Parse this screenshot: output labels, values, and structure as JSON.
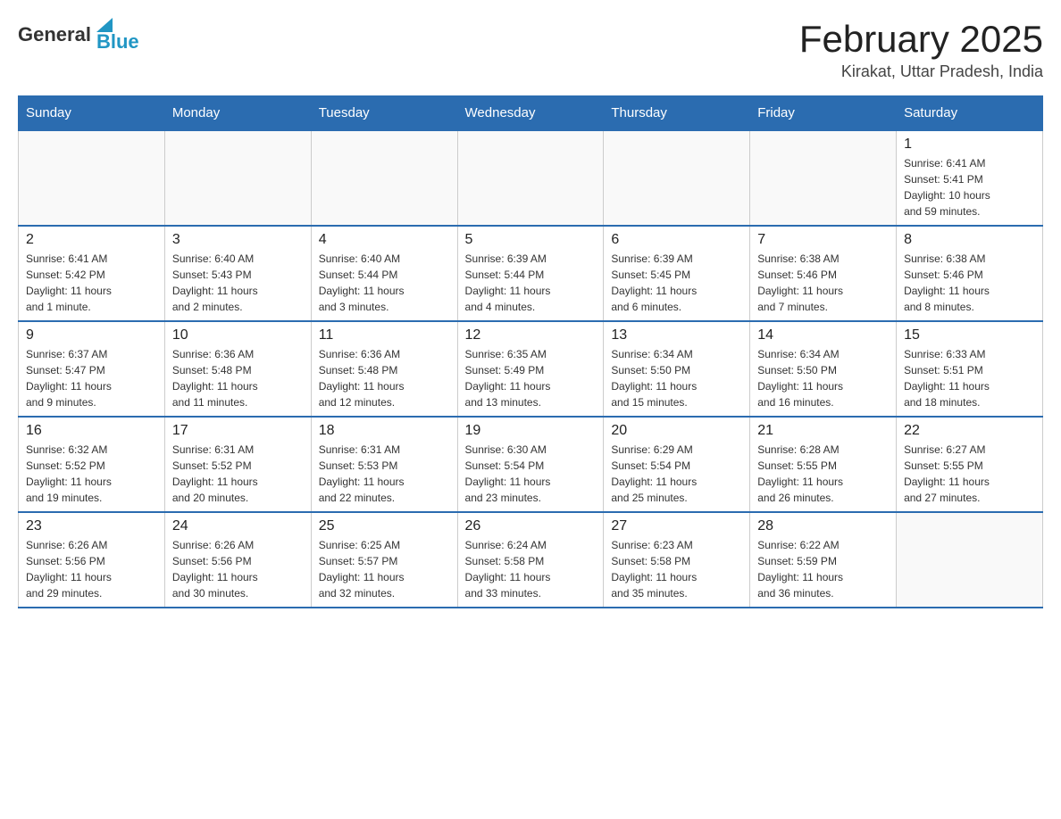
{
  "header": {
    "logo_general": "General",
    "logo_blue": "Blue",
    "month_year": "February 2025",
    "location": "Kirakat, Uttar Pradesh, India"
  },
  "days_of_week": [
    "Sunday",
    "Monday",
    "Tuesday",
    "Wednesday",
    "Thursday",
    "Friday",
    "Saturday"
  ],
  "weeks": [
    {
      "days": [
        {
          "number": "",
          "info": ""
        },
        {
          "number": "",
          "info": ""
        },
        {
          "number": "",
          "info": ""
        },
        {
          "number": "",
          "info": ""
        },
        {
          "number": "",
          "info": ""
        },
        {
          "number": "",
          "info": ""
        },
        {
          "number": "1",
          "info": "Sunrise: 6:41 AM\nSunset: 5:41 PM\nDaylight: 10 hours\nand 59 minutes."
        }
      ]
    },
    {
      "days": [
        {
          "number": "2",
          "info": "Sunrise: 6:41 AM\nSunset: 5:42 PM\nDaylight: 11 hours\nand 1 minute."
        },
        {
          "number": "3",
          "info": "Sunrise: 6:40 AM\nSunset: 5:43 PM\nDaylight: 11 hours\nand 2 minutes."
        },
        {
          "number": "4",
          "info": "Sunrise: 6:40 AM\nSunset: 5:44 PM\nDaylight: 11 hours\nand 3 minutes."
        },
        {
          "number": "5",
          "info": "Sunrise: 6:39 AM\nSunset: 5:44 PM\nDaylight: 11 hours\nand 4 minutes."
        },
        {
          "number": "6",
          "info": "Sunrise: 6:39 AM\nSunset: 5:45 PM\nDaylight: 11 hours\nand 6 minutes."
        },
        {
          "number": "7",
          "info": "Sunrise: 6:38 AM\nSunset: 5:46 PM\nDaylight: 11 hours\nand 7 minutes."
        },
        {
          "number": "8",
          "info": "Sunrise: 6:38 AM\nSunset: 5:46 PM\nDaylight: 11 hours\nand 8 minutes."
        }
      ]
    },
    {
      "days": [
        {
          "number": "9",
          "info": "Sunrise: 6:37 AM\nSunset: 5:47 PM\nDaylight: 11 hours\nand 9 minutes."
        },
        {
          "number": "10",
          "info": "Sunrise: 6:36 AM\nSunset: 5:48 PM\nDaylight: 11 hours\nand 11 minutes."
        },
        {
          "number": "11",
          "info": "Sunrise: 6:36 AM\nSunset: 5:48 PM\nDaylight: 11 hours\nand 12 minutes."
        },
        {
          "number": "12",
          "info": "Sunrise: 6:35 AM\nSunset: 5:49 PM\nDaylight: 11 hours\nand 13 minutes."
        },
        {
          "number": "13",
          "info": "Sunrise: 6:34 AM\nSunset: 5:50 PM\nDaylight: 11 hours\nand 15 minutes."
        },
        {
          "number": "14",
          "info": "Sunrise: 6:34 AM\nSunset: 5:50 PM\nDaylight: 11 hours\nand 16 minutes."
        },
        {
          "number": "15",
          "info": "Sunrise: 6:33 AM\nSunset: 5:51 PM\nDaylight: 11 hours\nand 18 minutes."
        }
      ]
    },
    {
      "days": [
        {
          "number": "16",
          "info": "Sunrise: 6:32 AM\nSunset: 5:52 PM\nDaylight: 11 hours\nand 19 minutes."
        },
        {
          "number": "17",
          "info": "Sunrise: 6:31 AM\nSunset: 5:52 PM\nDaylight: 11 hours\nand 20 minutes."
        },
        {
          "number": "18",
          "info": "Sunrise: 6:31 AM\nSunset: 5:53 PM\nDaylight: 11 hours\nand 22 minutes."
        },
        {
          "number": "19",
          "info": "Sunrise: 6:30 AM\nSunset: 5:54 PM\nDaylight: 11 hours\nand 23 minutes."
        },
        {
          "number": "20",
          "info": "Sunrise: 6:29 AM\nSunset: 5:54 PM\nDaylight: 11 hours\nand 25 minutes."
        },
        {
          "number": "21",
          "info": "Sunrise: 6:28 AM\nSunset: 5:55 PM\nDaylight: 11 hours\nand 26 minutes."
        },
        {
          "number": "22",
          "info": "Sunrise: 6:27 AM\nSunset: 5:55 PM\nDaylight: 11 hours\nand 27 minutes."
        }
      ]
    },
    {
      "days": [
        {
          "number": "23",
          "info": "Sunrise: 6:26 AM\nSunset: 5:56 PM\nDaylight: 11 hours\nand 29 minutes."
        },
        {
          "number": "24",
          "info": "Sunrise: 6:26 AM\nSunset: 5:56 PM\nDaylight: 11 hours\nand 30 minutes."
        },
        {
          "number": "25",
          "info": "Sunrise: 6:25 AM\nSunset: 5:57 PM\nDaylight: 11 hours\nand 32 minutes."
        },
        {
          "number": "26",
          "info": "Sunrise: 6:24 AM\nSunset: 5:58 PM\nDaylight: 11 hours\nand 33 minutes."
        },
        {
          "number": "27",
          "info": "Sunrise: 6:23 AM\nSunset: 5:58 PM\nDaylight: 11 hours\nand 35 minutes."
        },
        {
          "number": "28",
          "info": "Sunrise: 6:22 AM\nSunset: 5:59 PM\nDaylight: 11 hours\nand 36 minutes."
        },
        {
          "number": "",
          "info": ""
        }
      ]
    }
  ]
}
